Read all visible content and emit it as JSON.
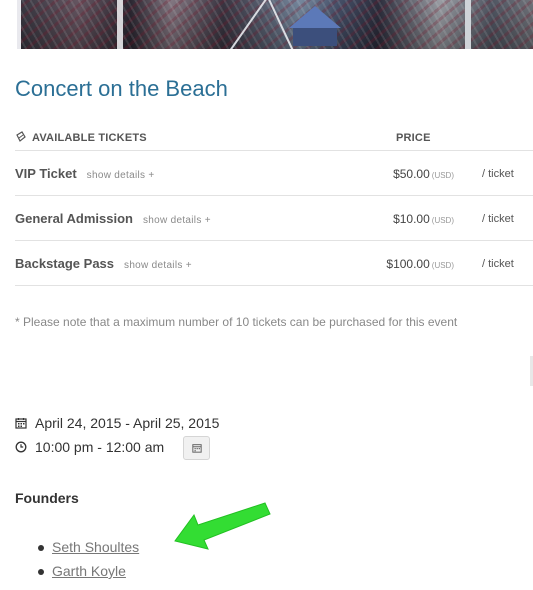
{
  "event": {
    "title": "Concert on the Beach"
  },
  "tickets": {
    "header_label": "AVAILABLE TICKETS",
    "price_header": "PRICE",
    "icon": "ticket-icon",
    "rows": [
      {
        "name": "VIP Ticket",
        "details": "show details +",
        "price": "$50.00",
        "currency": "(USD)",
        "per": "/ ticket"
      },
      {
        "name": "General Admission",
        "details": "show details +",
        "price": "$10.00",
        "currency": "(USD)",
        "per": "/ ticket"
      },
      {
        "name": "Backstage Pass",
        "details": "show details +",
        "price": "$100.00",
        "currency": "(USD)",
        "per": "/ ticket"
      }
    ],
    "note": "* Please note that a maximum number of 10 tickets can be purchased for this event"
  },
  "schedule": {
    "date": "April 24, 2015 - April 25, 2015",
    "time": "10:00 pm - 12:00 am",
    "date_icon": "calendar-icon",
    "time_icon": "clock-icon",
    "add_to_calendar_icon": "calendar-icon"
  },
  "founders": {
    "heading": "Founders",
    "items": [
      "Seth Shoultes",
      "Garth Koyle"
    ]
  },
  "colors": {
    "title": "#2b6f95",
    "arrow": "#33dd33"
  }
}
